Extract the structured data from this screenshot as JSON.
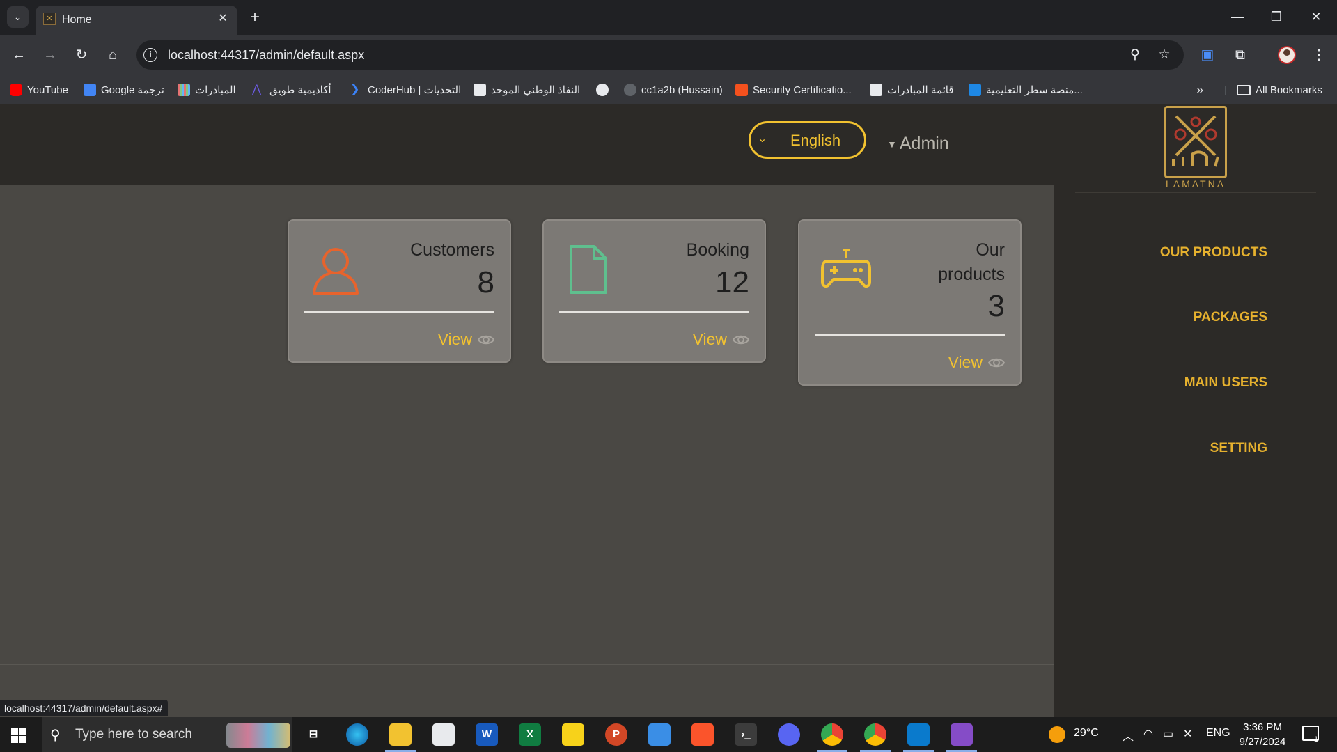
{
  "browser": {
    "tab_title": "Home",
    "url": "localhost:44317/admin/default.aspx",
    "status_url": "localhost:44317/admin/default.aspx#"
  },
  "bookmarks": [
    {
      "label": "YouTube",
      "icon": "youtube-icon",
      "color": "#ff0000"
    },
    {
      "label": "Google ترجمة",
      "icon": "google-translate-icon",
      "color": "#4285f4"
    },
    {
      "label": "المبادرات",
      "icon": "initiatives-icon",
      "color": "#e57373"
    },
    {
      "label": "أكاديمية طويق",
      "icon": "tuwaiq-icon",
      "color": "#5b4bd1"
    },
    {
      "label": "CoderHub | التحديات",
      "icon": "coderhub-icon",
      "color": "#3b82f6"
    },
    {
      "label": "النفاذ الوطني الموحد",
      "icon": "nafath-icon",
      "color": "#2e7d32"
    },
    {
      "label": "",
      "icon": "globe-icon",
      "color": "#e8eaed"
    },
    {
      "label": "cc1a2b (Hussain)",
      "icon": "github-icon",
      "color": "#e8eaed"
    },
    {
      "label": "Security Certificatio...",
      "icon": "security-cert-icon",
      "color": "#f4511e"
    },
    {
      "label": "قائمة المبادرات",
      "icon": "initiatives-list-icon",
      "color": "#e8eaed"
    },
    {
      "label": "منصة سطر التعليمية...",
      "icon": "satr-icon",
      "color": "#1e88e5"
    }
  ],
  "bookmarks_all": "All Bookmarks",
  "header": {
    "language": "English",
    "user": "Admin"
  },
  "cards": [
    {
      "title": "Customers",
      "count": "8",
      "view": "View",
      "icon": "user-icon",
      "color": "#e8632c"
    },
    {
      "title": "Booking",
      "count": "12",
      "view": "View",
      "icon": "document-icon",
      "color": "#5fbf8e"
    },
    {
      "title_line1": "Our",
      "title_line2": "products",
      "count": "3",
      "view": "View",
      "icon": "gamepad-icon",
      "color": "#f2c230"
    }
  ],
  "sidebar": {
    "logo_text": "LAMATNA",
    "items": [
      {
        "label": "OUR PRODUCTS"
      },
      {
        "label": "PACKAGES"
      },
      {
        "label": "MAIN USERS"
      },
      {
        "label": "SETTING"
      }
    ]
  },
  "taskbar": {
    "search_placeholder": "Type here to search",
    "temperature": "29°C",
    "language": "ENG",
    "time": "3:36 PM",
    "date": "9/27/2024",
    "notifications": "1"
  }
}
